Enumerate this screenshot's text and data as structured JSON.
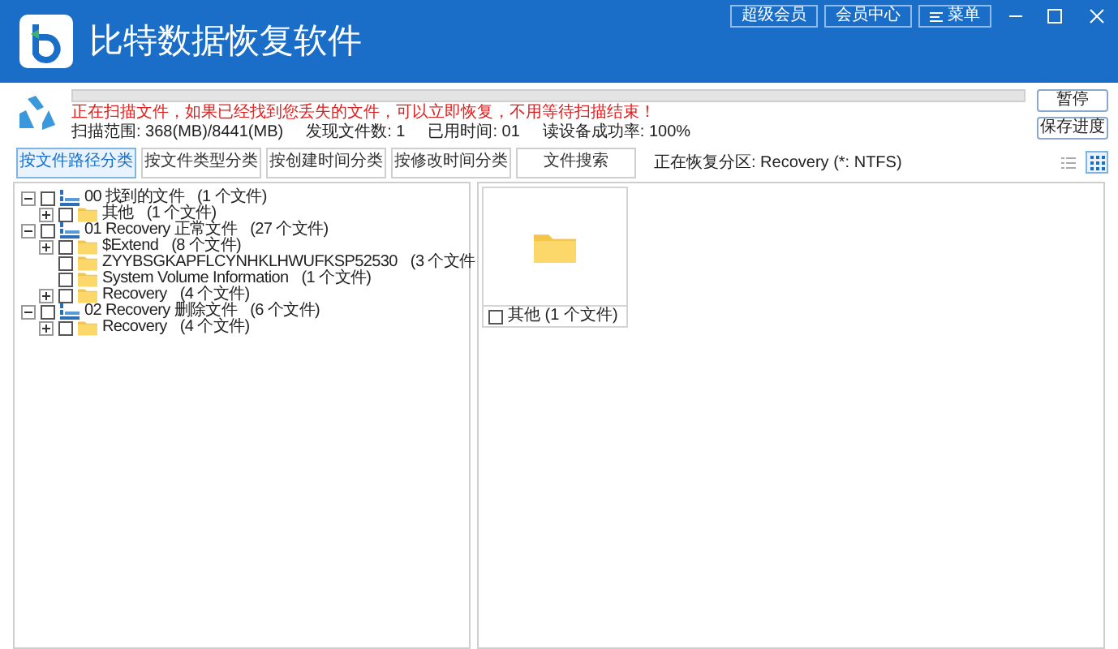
{
  "window": {
    "title": "比特数据恢复软件",
    "header_buttons": [
      "超级会员",
      "会员中心",
      "菜单"
    ]
  },
  "scan": {
    "level": 0,
    "warning": "正在扫描文件，如果已经找到您丢失的文件，可以立即恢复，不用等待扫描结束！",
    "stats": [
      "扫描范围: 368(MB)/8441(MB)",
      "发现文件数: 1",
      "已用时间: 01",
      "读设备成功率: 100%"
    ],
    "buttons": [
      "暂停",
      "保存进度"
    ]
  },
  "tabs": [
    {
      "label": "按文件路径分类",
      "selected": true
    },
    {
      "label": "按文件类型分类",
      "selected": false
    },
    {
      "label": "按创建时间分类",
      "selected": false
    },
    {
      "label": "按修改时间分类",
      "selected": false
    },
    {
      "label": "文件搜索",
      "selected": false
    }
  ],
  "partition": "正在恢复分区: Recovery (*: NTFS)",
  "view_modes": [
    {
      "kind": "list",
      "selected": false
    },
    {
      "kind": "grid",
      "selected": true
    }
  ],
  "tree": [
    {
      "name": "00 找到的文件",
      "count": "(1 个文件)",
      "checked": false,
      "expanded": true,
      "children": [
        {
          "name": "其他",
          "count": "(1 个文件)",
          "checked": false,
          "has_children": true
        }
      ]
    },
    {
      "name": "01 Recovery 正常文件",
      "count": "(27 个文件)",
      "checked": false,
      "expanded": true,
      "children": [
        {
          "name": "$Extend",
          "count": "(8 个文件)",
          "checked": false,
          "has_children": true
        },
        {
          "name": "ZYYBSGKAPFLCYNHKLHWUFKSP52530",
          "count": "(3 个文件",
          "checked": false,
          "has_children": false
        },
        {
          "name": "System Volume Information",
          "count": "(1 个文件)",
          "checked": false,
          "has_children": false
        },
        {
          "name": "Recovery",
          "count": "(4 个文件)",
          "checked": false,
          "has_children": true
        }
      ]
    },
    {
      "name": "02 Recovery 删除文件",
      "count": "(6 个文件)",
      "checked": false,
      "expanded": true,
      "children": [
        {
          "name": "Recovery",
          "count": "(4 个文件)",
          "checked": false,
          "has_children": true
        }
      ]
    }
  ],
  "files": [
    {
      "label": "其他 (1 个文件)",
      "checked": false
    }
  ]
}
